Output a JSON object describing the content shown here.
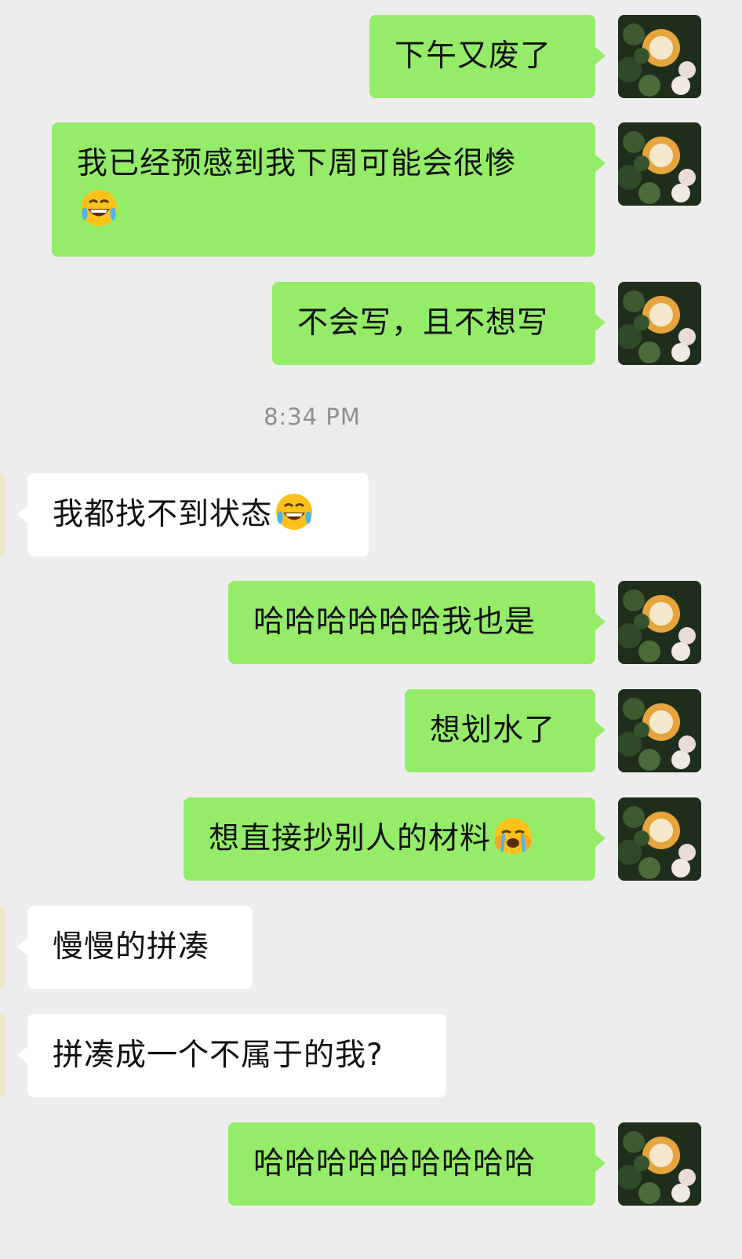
{
  "timestamp": "8:34 PM",
  "messages": [
    {
      "from": "me",
      "text": "下午又废了"
    },
    {
      "from": "me",
      "text": "我已经预感到我下周可能会很惨",
      "emoji": "face-with-tears-of-joy"
    },
    {
      "from": "me",
      "text": "不会写，且不想写"
    },
    {
      "from": "them",
      "text": "我都找不到状态",
      "emoji": "face-with-tears-of-joy"
    },
    {
      "from": "me",
      "text": "哈哈哈哈哈哈我也是"
    },
    {
      "from": "me",
      "text": "想划水了"
    },
    {
      "from": "me",
      "text": "想直接抄别人的材料",
      "emoji": "loudly-crying-face"
    },
    {
      "from": "them",
      "text": "慢慢的拼凑"
    },
    {
      "from": "them",
      "text": "拼凑成一个不属于的我?"
    },
    {
      "from": "me",
      "text": "哈哈哈哈哈哈哈哈哈"
    }
  ],
  "colors": {
    "background": "#ededed",
    "my_bubble": "#95ec69",
    "their_bubble": "#ffffff",
    "timestamp_text": "#8f8f8f"
  }
}
